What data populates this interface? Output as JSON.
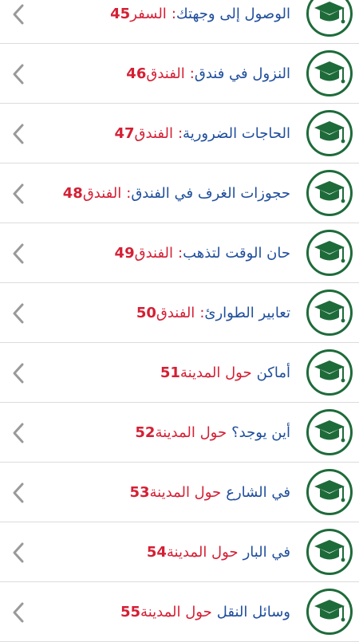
{
  "colors": {
    "number": "#d51f34",
    "category": "#d51f34",
    "topic": "#1f4e9c",
    "icon": "#1e6b3a",
    "chevron": "#9a9a9a"
  },
  "icons": {
    "badge": "graduation-cap-icon",
    "chevron": "chevron-left-icon"
  },
  "lessons": [
    {
      "num": "45",
      "cat": "السفر",
      "sep": ":",
      "topic": "الوصول إلى وجهتك"
    },
    {
      "num": "46",
      "cat": "الفندق",
      "sep": ":",
      "topic": "النزول في فندق"
    },
    {
      "num": "47",
      "cat": "الفندق",
      "sep": ":",
      "topic": "الحاجات الضرورية"
    },
    {
      "num": "48",
      "cat": "الفندق",
      "sep": ":",
      "topic": "حجوزات الغرف في الفندق"
    },
    {
      "num": "49",
      "cat": "الفندق",
      "sep": ":",
      "topic": "حان الوقت لتذهب"
    },
    {
      "num": "50",
      "cat": "الفندق",
      "sep": ":",
      "topic": "تعابير الطوارئ"
    },
    {
      "num": "51",
      "cat": "حول المدينة",
      "sep": "",
      "topic": "أماكن"
    },
    {
      "num": "52",
      "cat": "حول المدينة",
      "sep": "",
      "topic": "أين يوجد؟"
    },
    {
      "num": "53",
      "cat": "حول المدينة",
      "sep": "",
      "topic": "في الشارع"
    },
    {
      "num": "54",
      "cat": "حول المدينة",
      "sep": "",
      "topic": "في البار"
    },
    {
      "num": "55",
      "cat": "حول المدينة",
      "sep": "",
      "topic": "وسائل النقل"
    }
  ]
}
